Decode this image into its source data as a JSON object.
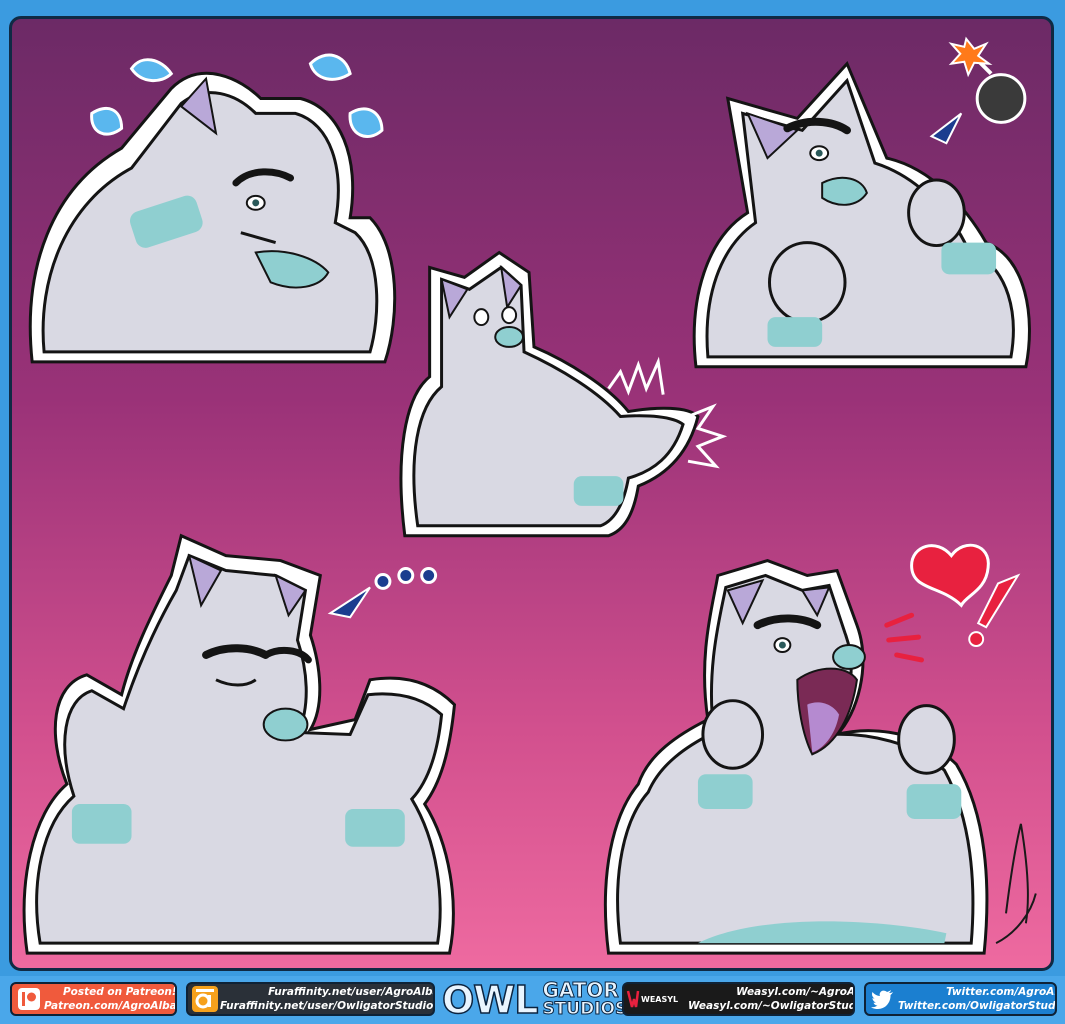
{
  "colors": {
    "bg_top": "#6c2a66",
    "bg_bottom": "#ee6aa0",
    "footer": "#4aa7ea",
    "fur": "#d9d9e3",
    "accent": "#8fcfd0",
    "outline": "#141414",
    "heart": "#e8213f",
    "drop": "#5ab7ee"
  },
  "stickers": [
    {
      "name": "nervous-sweating"
    },
    {
      "name": "angry-fist-bomb"
    },
    {
      "name": "clapping"
    },
    {
      "name": "shrug-ellipsis"
    },
    {
      "name": "excited-heart"
    }
  ],
  "footer": {
    "patreon": {
      "icon": "patreon-icon",
      "line1": "Posted on Patreon!",
      "line2": "Patreon.com/AgroAlba"
    },
    "furaffinity": {
      "icon": "furaffinity-icon",
      "line1": "Furaffinity.net/user/AgroAlba",
      "line2": "Furaffinity.net/user/OwligatorStudios"
    },
    "logo": {
      "owl": "OWL",
      "gator": "GATOR",
      "studios": "STUDIOS"
    },
    "weasyl": {
      "icon": "weasyl-icon",
      "word": "WEASYL",
      "line1": "Weasyl.com/~AgroAlba",
      "line2": "Weasyl.com/~OwligatorStudios"
    },
    "twitter": {
      "icon": "twitter-bird-icon",
      "line1": "Twitter.com/AgroAlba",
      "line2": "Twitter.com/OwligatorStudios"
    }
  }
}
